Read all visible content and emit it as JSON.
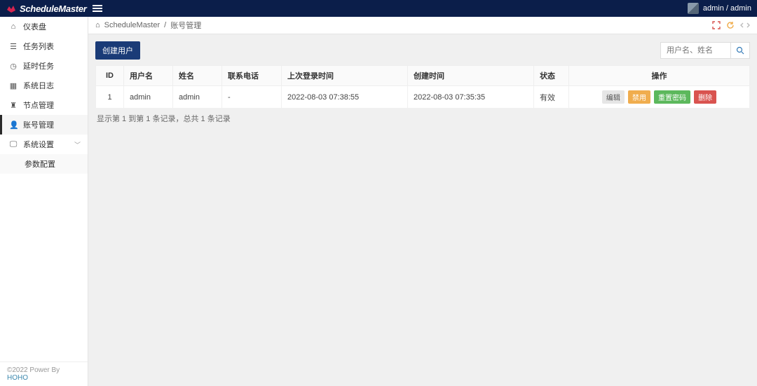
{
  "brand": "ScheduleMaster",
  "user": {
    "display": "admin / admin"
  },
  "sidebar": {
    "items": [
      {
        "label": "仪表盘",
        "icon": "home"
      },
      {
        "label": "任务列表",
        "icon": "list"
      },
      {
        "label": "延时任务",
        "icon": "clock"
      },
      {
        "label": "系统日志",
        "icon": "grid"
      },
      {
        "label": "节点管理",
        "icon": "nodes"
      },
      {
        "label": "账号管理",
        "icon": "user",
        "active": true
      },
      {
        "label": "系统设置",
        "icon": "monitor",
        "expandable": true
      }
    ],
    "sub": {
      "label": "参数配置"
    },
    "footer_prefix": "©2022 Power By ",
    "footer_link": "HOHO"
  },
  "breadcrumb": {
    "root": "ScheduleMaster",
    "sep": "/",
    "current": "账号管理"
  },
  "toolbar": {
    "create_label": "创建用户",
    "search_placeholder": "用户名、姓名"
  },
  "table": {
    "headers": {
      "id": "ID",
      "username": "用户名",
      "realname": "姓名",
      "phone": "联系电话",
      "last_login": "上次登录时间",
      "created": "创建时间",
      "status": "状态",
      "actions": "操作"
    },
    "rows": [
      {
        "id": "1",
        "username": "admin",
        "realname": "admin",
        "phone": "-",
        "last_login": "2022-08-03 07:38:55",
        "created": "2022-08-03 07:35:35",
        "status": "有效"
      }
    ],
    "actions": {
      "edit": "编辑",
      "disable": "禁用",
      "reset_pwd": "重置密码",
      "delete": "删除"
    },
    "summary": "显示第 1 到第 1 条记录，总共 1 条记录"
  }
}
